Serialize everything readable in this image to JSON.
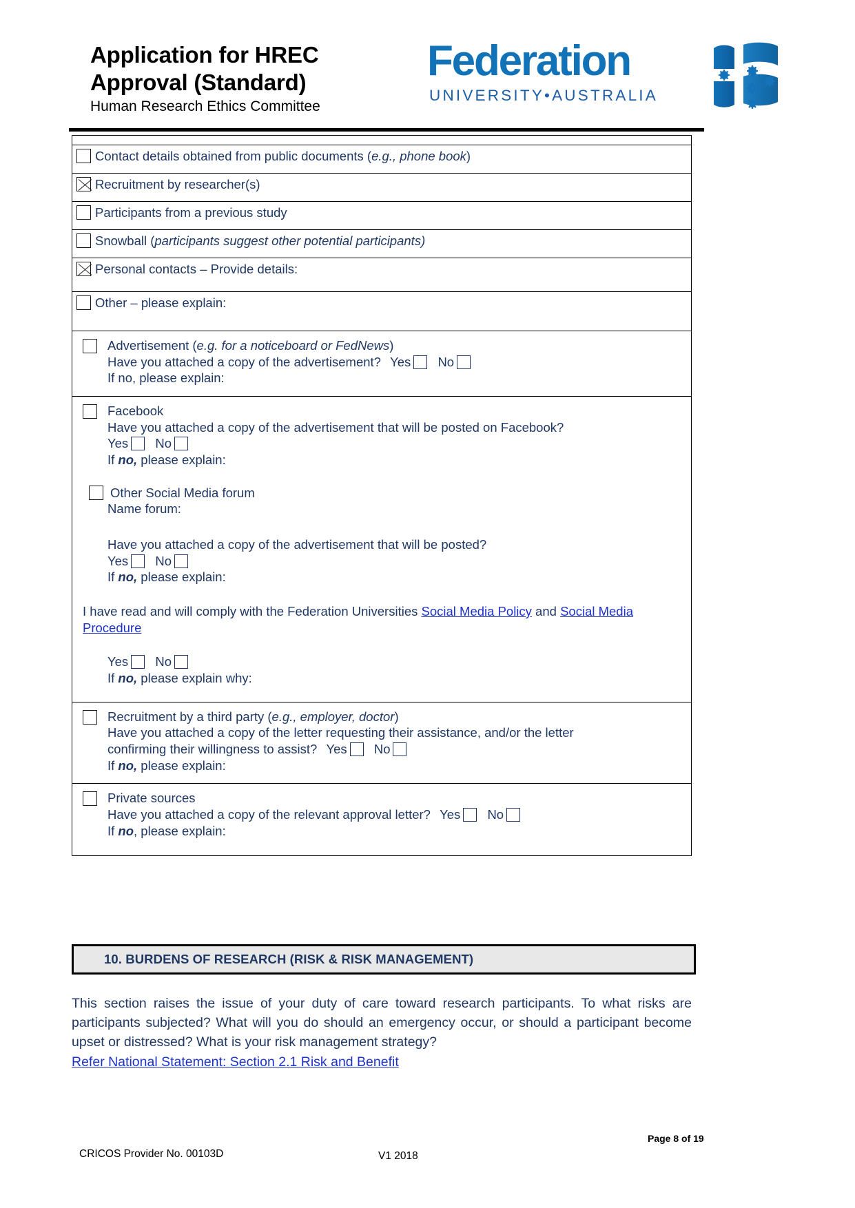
{
  "header": {
    "title_line1": "Application for HREC",
    "title_line2": "Approval (Standard)",
    "subtitle": "Human Research Ethics Committee",
    "logo_word": "Federation",
    "logo_sub": "UNIVERSITY•AUSTRALIA",
    "logo_blue": "#1272b8"
  },
  "form": {
    "rows": {
      "contact_details": "Contact details obtained from public documents (",
      "contact_details_italic": "e.g., phone book",
      "contact_details_end": ")",
      "recruitment_researcher": "Recruitment by researcher(s)",
      "previous_study": "Participants from a previous study",
      "snowball_pre": "Snowball (",
      "snowball_italic": "participants suggest other potential participants)",
      "personal_contacts": "Personal contacts – Provide details:",
      "other_explain": "Other – please explain:"
    },
    "advertisement": {
      "label_pre": "Advertisement (",
      "label_italic": "e.g. for a noticeboard or FedNews",
      "label_end": ")",
      "question": "Have you attached a copy of the advertisement?",
      "yes": "Yes",
      "no": "No",
      "if_no": "If no, please explain:"
    },
    "facebook": {
      "label": "Facebook",
      "question": "Have you attached a copy of the advertisement that will be posted on Facebook?",
      "yes": "Yes",
      "no": "No",
      "if_prefix": "If ",
      "if_bold": "no,",
      "if_suffix": " please explain:"
    },
    "other_social": {
      "label": "Other Social Media forum",
      "name_forum": "Name forum:",
      "question": "Have you attached a copy of the advertisement that will be posted?",
      "yes": "Yes",
      "no": "No",
      "if_prefix": "If ",
      "if_bold": "no,",
      "if_suffix": " please explain:"
    },
    "policy": {
      "text_pre": "I have read and will comply with the Federation Universities ",
      "link1": "Social Media Policy",
      "text_mid": " and ",
      "link2": "Social Media Procedure",
      "yes": "Yes",
      "no": "No",
      "if_prefix": "If ",
      "if_bold": "no,",
      "if_suffix": " please explain why:"
    },
    "third_party": {
      "label_pre": "Recruitment by a third party (",
      "label_italic": "e.g., employer, doctor",
      "label_end": ")",
      "question_line1": "Have you attached a copy of the letter requesting their assistance, and/or the letter",
      "question_line2": "confirming their willingness to assist?",
      "yes": "Yes",
      "no": "No",
      "if_prefix": "If ",
      "if_bold": "no,",
      "if_suffix": " please explain:"
    },
    "private_sources": {
      "label": "Private sources",
      "question": "Have you attached a copy of the relevant approval letter?",
      "yes": "Yes",
      "no": "No",
      "if_prefix": "If ",
      "if_bold": "no",
      "if_suffix": ", please explain:"
    }
  },
  "section10": {
    "title": "10. BURDENS OF RESEARCH (RISK & RISK MANAGEMENT)",
    "paragraph": "This section raises the issue of your duty of care toward research participants. To what risks are participants subjected? What will you do should an emergency occur, or should a participant become upset or distressed? What is your risk management strategy?",
    "refer_link": "Refer National Statement: Section 2.1 Risk and Benefit"
  },
  "footer": {
    "cricos": "CRICOS Provider No. 00103D",
    "version": "V1   2018",
    "page": "Page 8 of 19"
  }
}
